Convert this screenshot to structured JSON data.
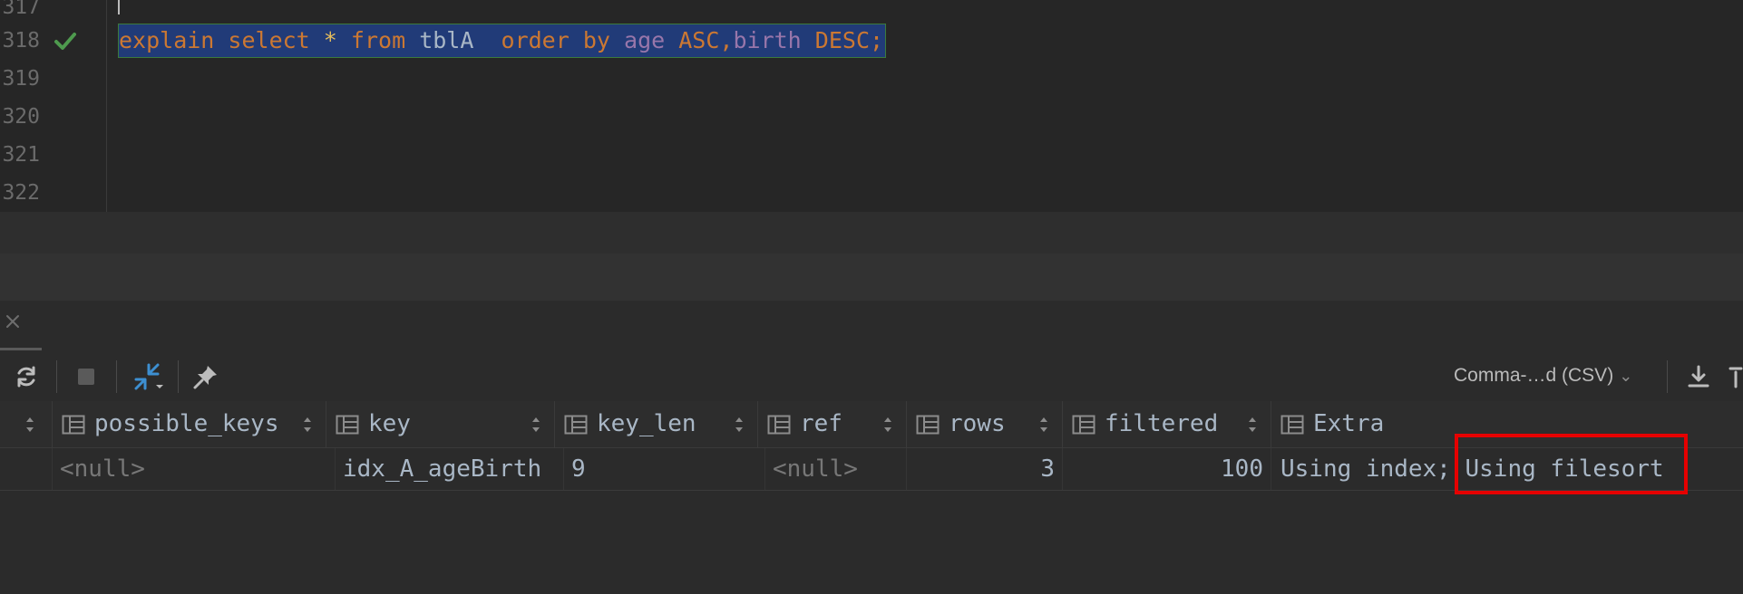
{
  "editor": {
    "line_numbers": [
      "317",
      "318",
      "319",
      "320",
      "321",
      "322"
    ],
    "statement": {
      "explain": "explain",
      "select": "select",
      "star": "*",
      "from": "from",
      "table": "tblA",
      "order": "order",
      "by": "by",
      "col1": "age",
      "asc": "ASC",
      "comma": ",",
      "col2": "birth",
      "desc": "DESC",
      "semicolon": ";"
    }
  },
  "toolbar": {
    "refresh_icon": "refresh-icon",
    "stop_icon": "stop-icon",
    "layout_icon": "compare-arrows-icon",
    "pin_icon": "pin-icon",
    "export_format": "Comma-…d (CSV)",
    "download_icon": "download-icon"
  },
  "grid": {
    "columns": [
      "possible_keys",
      "key",
      "key_len",
      "ref",
      "rows",
      "filtered",
      "Extra"
    ],
    "rows": [
      [
        "<null>",
        "idx_A_ageBirth",
        "9",
        "<null>",
        "3",
        "100",
        "Using index;",
        "Using filesort"
      ]
    ]
  },
  "colors": {
    "keyword": "#cc7832",
    "column": "#9876aa",
    "selection": "#213b78",
    "highlight_box": "#e60000",
    "check": "#4e9a4e"
  }
}
